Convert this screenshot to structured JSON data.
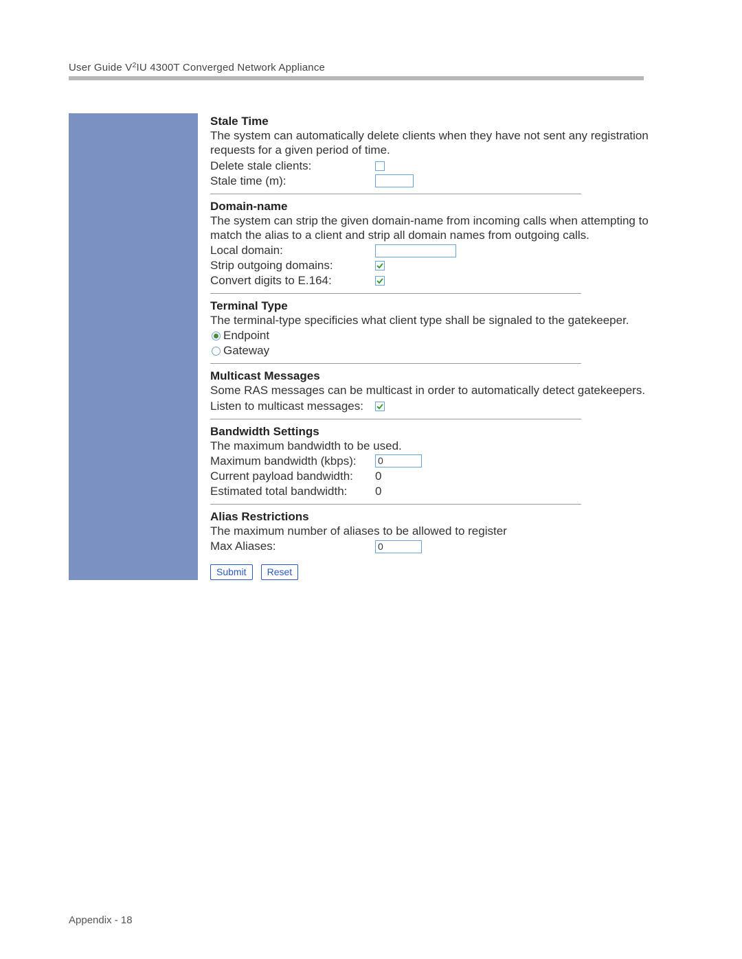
{
  "header": {
    "title_prefix": "User Guide V",
    "title_sup": "2",
    "title_suffix": "IU 4300T Converged Network Appliance"
  },
  "staleTime": {
    "title": "Stale Time",
    "desc": "The system can automatically delete clients when they have not sent any registration requests for a given period of time.",
    "deleteLabel": "Delete stale clients:",
    "deleteChecked": false,
    "staleLabel": "Stale time (m):",
    "staleValue": ""
  },
  "domainName": {
    "title": "Domain-name",
    "desc": "The system can strip the given domain-name from incoming calls when attempting to match the alias to a client and strip all domain names from outgoing calls.",
    "localLabel": "Local domain:",
    "localValue": "",
    "stripLabel": "Strip outgoing domains:",
    "stripChecked": true,
    "convertLabel": "Convert digits to E.164:",
    "convertChecked": true
  },
  "terminalType": {
    "title": "Terminal Type",
    "desc": "The terminal-type specificies what client type shall be signaled to the gatekeeper.",
    "options": [
      {
        "label": "Endpoint",
        "selected": true
      },
      {
        "label": "Gateway",
        "selected": false
      }
    ]
  },
  "multicast": {
    "title": "Multicast Messages",
    "desc": "Some RAS messages can be multicast in order to automatically detect gatekeepers.",
    "listenLabel": "Listen to multicast messages:",
    "listenChecked": true
  },
  "bandwidth": {
    "title": "Bandwidth Settings",
    "desc": "The maximum bandwidth to be used.",
    "maxLabel": "Maximum bandwidth (kbps):",
    "maxValue": "0",
    "currentLabel": "Current payload bandwidth:",
    "currentValue": "0",
    "estLabel": "Estimated total bandwidth:",
    "estValue": "0"
  },
  "alias": {
    "title": "Alias Restrictions",
    "desc": "The maximum number of aliases to be allowed to register",
    "maxLabel": "Max Aliases:",
    "maxValue": "0"
  },
  "buttons": {
    "submit": "Submit",
    "reset": "Reset"
  },
  "footer": "Appendix - 18"
}
